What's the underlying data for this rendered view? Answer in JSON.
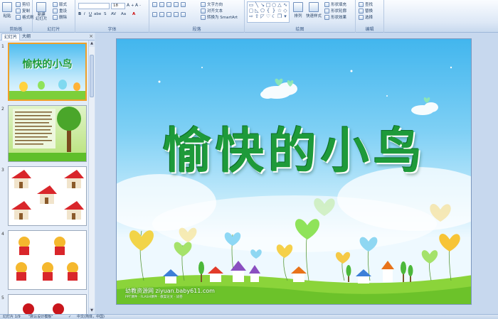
{
  "colors": {
    "ribbon_bg": "#dde8f6",
    "selected_thumb_border": "#f0a028",
    "title_green": "#1e9a3a",
    "sky_top": "#42b6ee"
  },
  "ribbon": {
    "clipboard": {
      "paste": "粘贴",
      "cut": "剪切",
      "copy": "复制",
      "format_painter": "格式刷",
      "label": "剪贴板"
    },
    "slides": {
      "new_slide": "新建\n幻灯片",
      "layout": "版式",
      "reset": "重设",
      "delete": "删除",
      "label": "幻灯片"
    },
    "font": {
      "font_size": "18",
      "label": "字体"
    },
    "paragraph": {
      "text_direction": "文字方向",
      "align_text": "对齐文本",
      "convert_smartart": "转换为 SmartArt",
      "label": "段落"
    },
    "drawing": {
      "arrange": "排列",
      "quick_styles": "快速样式",
      "shape_fill": "形状填充",
      "shape_outline": "形状轮廓",
      "shape_effects": "形状效果",
      "label": "绘图"
    },
    "editing": {
      "find": "查找",
      "replace": "替换",
      "select": "选择",
      "label": "编辑"
    }
  },
  "panel": {
    "tab_slides": "幻灯片",
    "tab_outline": "大纲",
    "close": "×"
  },
  "thumbnails": [
    {
      "num": "1",
      "title": "愉快的小鸟"
    },
    {
      "num": "2"
    },
    {
      "num": "3"
    },
    {
      "num": "4"
    },
    {
      "num": "5"
    }
  ],
  "slide": {
    "title": "愉快的小鸟",
    "watermark": "幼教资源网 ziyuan.baby611.com",
    "subwatermark": "PPT课件 · FLASH课件 · 教案论文 · 试卷"
  },
  "status": {
    "slide_index": "幻灯片 1/9",
    "theme": "\"默认设计模板\"",
    "language": "中文(简体，中国)"
  }
}
